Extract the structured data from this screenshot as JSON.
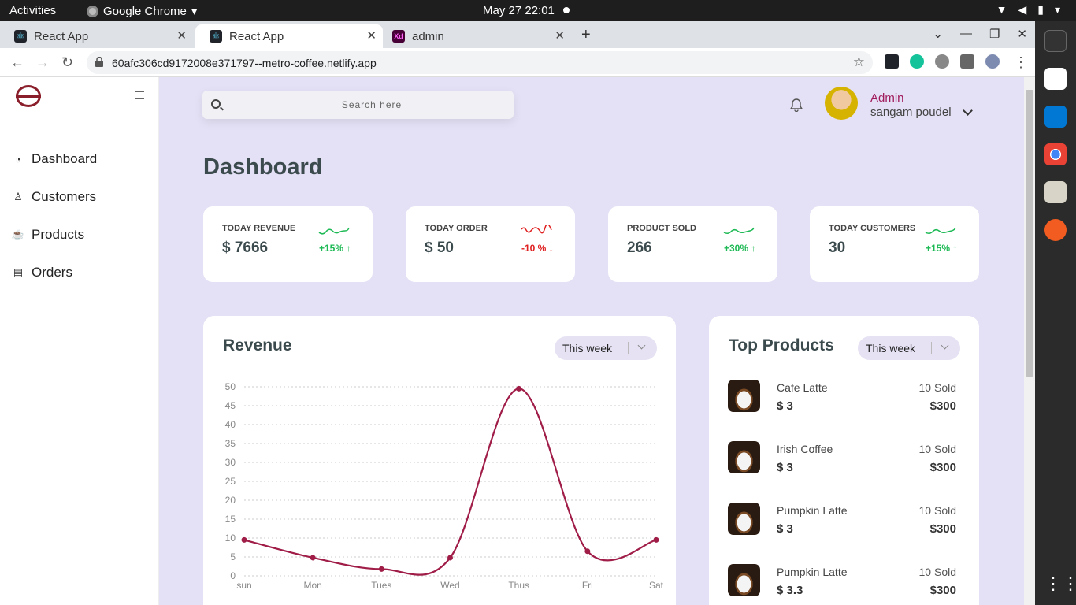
{
  "os": {
    "activities": "Activities",
    "app_name": "Google Chrome",
    "clock": "May 27  22:01"
  },
  "browser": {
    "tabs": [
      {
        "label": "React App",
        "active": false
      },
      {
        "label": "React App",
        "active": true
      },
      {
        "label": "admin",
        "active": false
      }
    ],
    "url": "60afc306cd9172008e371797--metro-coffee.netlify.app"
  },
  "sidebar": {
    "items": [
      {
        "label": "Dashboard",
        "icon": "gauge-icon"
      },
      {
        "label": "Customers",
        "icon": "user-icon"
      },
      {
        "label": "Products",
        "icon": "coffee-icon"
      },
      {
        "label": "Orders",
        "icon": "receipt-icon"
      }
    ]
  },
  "header": {
    "search_placeholder": "Search here",
    "user_role": "Admin",
    "user_name": "sangam poudel"
  },
  "page_title": "Dashboard",
  "stats": [
    {
      "label": "TODAY REVENUE",
      "value": "$ 7666",
      "change": "+15%",
      "trend": "up"
    },
    {
      "label": "TODAY ORDER",
      "value": "$ 50",
      "change": "-10 %",
      "trend": "down"
    },
    {
      "label": "PRODUCT SOLD",
      "value": "266",
      "change": "+30%",
      "trend": "up"
    },
    {
      "label": "TODAY CUSTOMERS",
      "value": "30",
      "change": "+15%",
      "trend": "up"
    }
  ],
  "revenue": {
    "title": "Revenue",
    "period": "This week"
  },
  "top_products": {
    "title": "Top Products",
    "period": "This week",
    "items": [
      {
        "name": "Cafe Latte",
        "price": "$ 3",
        "sold": "10 Sold",
        "total": "$300"
      },
      {
        "name": "Irish Coffee",
        "price": "$ 3",
        "sold": "10 Sold",
        "total": "$300"
      },
      {
        "name": "Pumpkin Latte",
        "price": "$ 3",
        "sold": "10 Sold",
        "total": "$300"
      },
      {
        "name": "Pumpkin Latte",
        "price": "$ 3.3",
        "sold": "10 Sold",
        "total": "$300"
      }
    ]
  },
  "chart_data": {
    "type": "line",
    "categories": [
      "sun",
      "Mon",
      "Tues",
      "Wed",
      "Thus",
      "Fri",
      "Sat"
    ],
    "series": [
      {
        "values": [
          9.5,
          4.8,
          1.8,
          4.8,
          49.5,
          6.5,
          9.5
        ]
      }
    ],
    "yticks": [
      0,
      5,
      10,
      15,
      20,
      25,
      30,
      35,
      40,
      45,
      50
    ],
    "ylim": [
      0,
      50
    ],
    "grid": true,
    "line_color": "#a01d48"
  },
  "colors": {
    "accent": "#a01b5b",
    "page_bg": "#e4e0f5",
    "up": "#1db954",
    "down": "#e02020"
  }
}
